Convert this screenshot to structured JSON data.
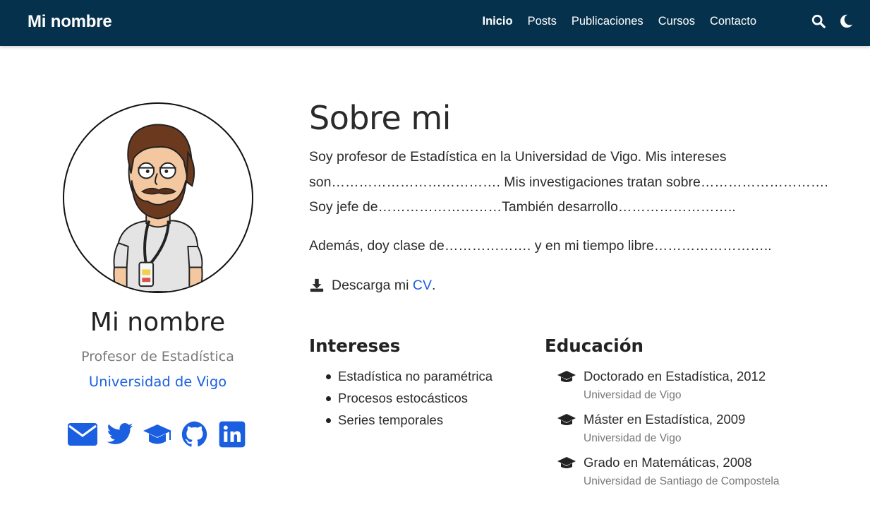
{
  "navbar": {
    "brand": "Mi nombre",
    "links": [
      {
        "label": "Inicio",
        "active": true
      },
      {
        "label": "Posts",
        "active": false
      },
      {
        "label": "Publicaciones",
        "active": false
      },
      {
        "label": "Cursos",
        "active": false
      },
      {
        "label": "Contacto",
        "active": false
      }
    ],
    "icons": [
      "search-icon",
      "moon-icon"
    ],
    "background": "#06314d"
  },
  "profile": {
    "name": "Mi nombre",
    "role": "Profesor de Estadística",
    "organization": "Universidad de Vigo",
    "social_icons": [
      "envelope-icon",
      "twitter-icon",
      "graduation-cap-icon",
      "github-icon",
      "linkedin-icon"
    ]
  },
  "about": {
    "title": "Sobre mi",
    "paragraphs": [
      "Soy profesor de Estadística en la Universidad de Vigo. Mis intereses son………………………………. Mis investigaciones tratan sobre………………………. Soy jefe de………………………También desarrollo……………………..",
      "Además, doy clase de………………. y en mi tiempo libre…………………….."
    ],
    "cv_prefix": "Descarga mi ",
    "cv_link": "CV",
    "cv_suffix": "."
  },
  "interests": {
    "title": "Intereses",
    "items": [
      "Estadística no paramétrica",
      "Procesos estocásticos",
      "Series temporales"
    ]
  },
  "education": {
    "title": "Educación",
    "items": [
      {
        "course": "Doctorado en Estadística, 2012",
        "institution": "Universidad de Vigo"
      },
      {
        "course": "Máster en Estadística, 2009",
        "institution": "Universidad de Vigo"
      },
      {
        "course": "Grado en Matemáticas, 2008",
        "institution": "Universidad de Santiago de Compostela"
      }
    ]
  },
  "colors": {
    "accent": "#1a5fe0",
    "text": "#2b2b2b",
    "muted": "#777777"
  }
}
